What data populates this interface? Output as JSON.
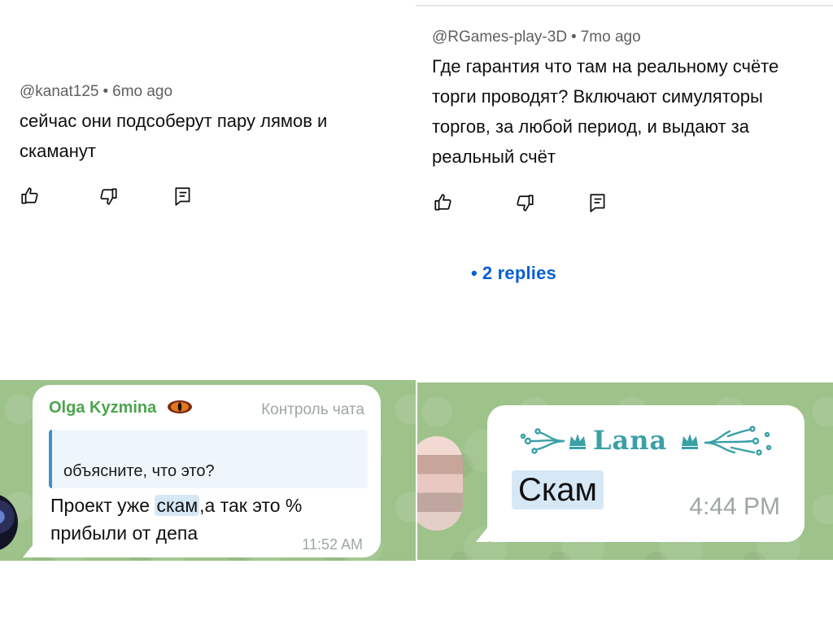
{
  "comments": [
    {
      "author": "@kanat125",
      "age": "6mo ago",
      "text": "сейчас они подсоберут пару лямов и скаманут",
      "text_line1": "сейчас они подсоберут пару лямов и",
      "text_line2": "скаманут",
      "replies": ""
    },
    {
      "author": "@RGames-play-3D",
      "age": "7mo ago",
      "text_line1": "Где гарантия что там на реальному счёте",
      "text_line2": "торги проводят? Включают симуляторы",
      "text_line3": "торгов, за любой период, и выдают за",
      "text_line4": "реальный счёт",
      "replies": "2 replies"
    }
  ],
  "separator": "•",
  "icons": {
    "like": "thumb-up-icon",
    "dislike": "thumb-down-icon",
    "reply": "reply-comment-icon"
  },
  "telegram": [
    {
      "sender": "Olga Kyzmina",
      "role": "Контроль чата",
      "quote": "объясните, что это?",
      "msg_before": "Проект уже ",
      "msg_highlight": "скам",
      "msg_after": ",а так это %",
      "msg_line2": "прибыли от депа",
      "time": "11:52 AM"
    },
    {
      "sender": "Lana",
      "msg_highlight": "Скам",
      "time": "4:44 PM"
    }
  ],
  "colors": {
    "youtube_meta": "#606060",
    "youtube_link": "#065fd4",
    "telegram_bg": "#9dc28a",
    "telegram_name_green": "#4ca54c",
    "telegram_lana_teal": "#3aa0a6",
    "telegram_quote_bar": "#3f8fcf",
    "highlight": "#d6e8f6"
  }
}
